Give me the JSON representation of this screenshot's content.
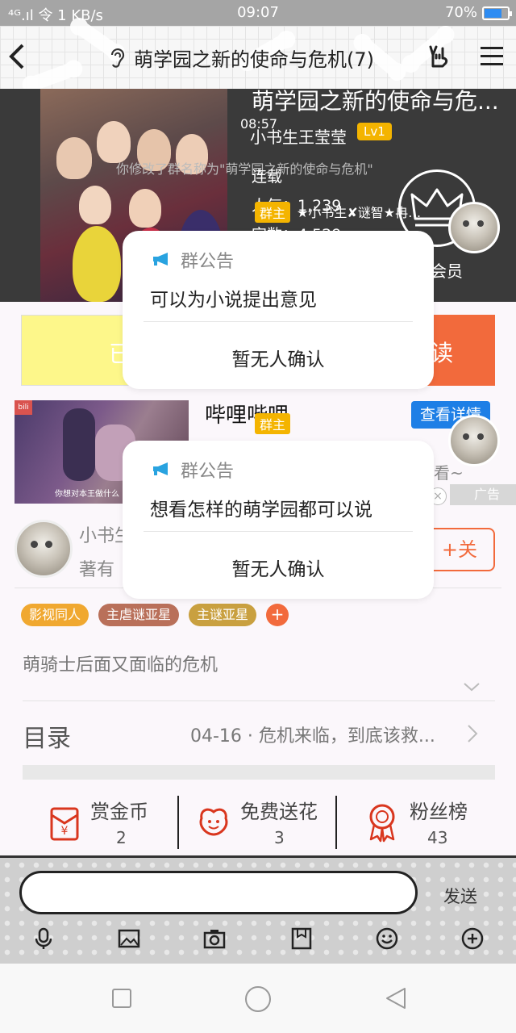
{
  "status_bar": {
    "network": "⁴ᴳ.ıl 令 1 KB/s",
    "time": "09:07",
    "battery": "70%",
    "battery_level": 0.7,
    "accent": "#2e8cf2"
  },
  "header": {
    "title": "萌学园之新的使命与危机(7)",
    "back_icon": "back-chevron-icon",
    "ear_icon": "ear-icon",
    "hand_icon": "rock-hand-icon",
    "menu_icon": "hamburger-menu-icon"
  },
  "cover": {
    "book_name": "萌学园之新的使命与危...",
    "time": "08:57",
    "author": "小书生王莹莹",
    "level": "Lv1",
    "system_msg": "你修改了群名称为\"萌学园之新的使命与危机\"",
    "serial": "连载",
    "popularity": "人气：1,239",
    "char_count": "字数：4,529",
    "owner_tag": "群主",
    "owner_name": "★小书生✘谜智★冉…",
    "vip_label": "会员"
  },
  "buttons": {
    "left_label": "已",
    "right_label": "读"
  },
  "ad": {
    "title": "哔哩哔哩",
    "owner_tag": "群主",
    "cta": "查看详情",
    "caption": "你想对本王做什么",
    "logo": "bili",
    "label": "广告",
    "snippet": "看~",
    "close": "×"
  },
  "author_row": {
    "name": "小书生",
    "sub": "著有",
    "follow": "+关注"
  },
  "tags": [
    {
      "label": "影视同人",
      "color": "#f0a830"
    },
    {
      "label": "主虐谜亚星",
      "color": "#b9705a"
    },
    {
      "label": "主谜亚星",
      "color": "#c9a040"
    }
  ],
  "tag_add": "+",
  "description": "萌骑士后面又面临的危机",
  "toc": {
    "label": "目录",
    "latest": "04-16 · 危机来临，到底该救..."
  },
  "stats": [
    {
      "label": "赏金币",
      "value": "2",
      "icon": "red-envelope-icon"
    },
    {
      "label": "免费送花",
      "value": "3",
      "icon": "flower-icon"
    },
    {
      "label": "粉丝榜",
      "value": "43",
      "icon": "medal-icon"
    }
  ],
  "input_bar": {
    "placeholder": "",
    "send": "发送"
  },
  "popups": [
    {
      "title": "群公告",
      "message": "可以为小说提出意见",
      "ack": "暂无人确认"
    },
    {
      "title": "群公告",
      "message": "想看怎样的萌学园都可以说",
      "ack": "暂无人确认"
    }
  ]
}
